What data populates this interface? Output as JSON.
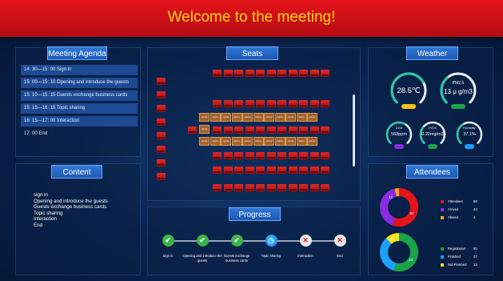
{
  "header": {
    "title": "Welcome to the meeting!"
  },
  "agenda": {
    "title": "Meeting Agenda",
    "items": [
      {
        "text": "14: 30—15: 00  Sign in",
        "highlight": true
      },
      {
        "text": "15: 00—15: 10  Opening and introduce the guests",
        "highlight": true
      },
      {
        "text": "15: 10—15: 15  Guests exchange business cards",
        "highlight": true
      },
      {
        "text": "15: 15—16: 15  Topic sharing",
        "highlight": true
      },
      {
        "text": "16: 15—17: 00  Interaction",
        "highlight": true
      },
      {
        "text": "17: 00  End",
        "highlight": false
      }
    ]
  },
  "content": {
    "title": "Content",
    "lines": [
      "sign in",
      "Opening and introduce the guests",
      "Guests exchange business cards",
      "Topic sharing",
      "Interaction",
      "End"
    ]
  },
  "seats": {
    "title": "Seats",
    "table_label": "name"
  },
  "progress": {
    "title": "Progress",
    "steps": [
      {
        "label": "Sign in",
        "status": "done"
      },
      {
        "label": "Opening and introduce the guests",
        "status": "done"
      },
      {
        "label": "Guests exchange business cards",
        "status": "done"
      },
      {
        "label": "Topic sharing",
        "status": "current"
      },
      {
        "label": "Interaction",
        "status": "pending"
      },
      {
        "label": "End",
        "status": "pending"
      }
    ]
  },
  "weather": {
    "title": "Weather",
    "temperature": {
      "value": "28.5℃",
      "level": 0.72,
      "color": "#f5c518"
    },
    "pm25": {
      "label": "PM2.5",
      "value": "13 μ g/m3",
      "level": 0.35,
      "color": "#1aa34a"
    },
    "co2": {
      "label": "CO2",
      "value": "568ppm",
      "level": 0.6,
      "color": "#8b2be2"
    },
    "tvoc": {
      "label": "TVOC",
      "value": "0.22mg/m3",
      "level": 0.3,
      "color": "#1aa34a"
    },
    "humidity": {
      "label": "Humidity",
      "value": "37.1%",
      "level": 0.37,
      "color": "#1ea0ff"
    }
  },
  "attendees": {
    "title": "Attendees",
    "chart1": [
      {
        "name": "Attendees",
        "value": 59,
        "color": "#e3141a"
      },
      {
        "name": "Arrived",
        "value": 43,
        "color": "#8b2be2"
      },
      {
        "name": "Absent",
        "value": 4,
        "color": "#f5a623"
      }
    ],
    "chart2": [
      {
        "name": "Registration",
        "value": 60,
        "color": "#1aa34a"
      },
      {
        "name": "Finished",
        "value": 37,
        "color": "#1ea0ff"
      },
      {
        "name": "Not Finished",
        "value": 13,
        "color": "#f5e51a"
      }
    ],
    "labels1": [
      "42",
      "18"
    ],
    "labels2": [
      "11",
      "18"
    ]
  }
}
